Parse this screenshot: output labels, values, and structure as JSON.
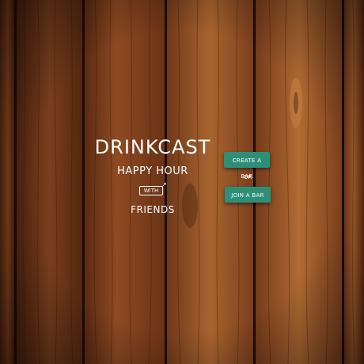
{
  "brand": {
    "title": "DRINKCAST",
    "line1": "HAPPY HOUR",
    "connector": "WITH",
    "line2": "FRIENDS"
  },
  "actions": {
    "create_label": "CREATE A BAR",
    "separator": "OR",
    "join_label": "JOIN A BAR"
  },
  "colors": {
    "button": "#2e8f79",
    "text": "#ffffff",
    "wood_dark": "#3d1c0c",
    "wood_mid": "#7a3d1c",
    "wood_light": "#a8622e"
  },
  "background": {
    "texture": "wood-planks"
  }
}
